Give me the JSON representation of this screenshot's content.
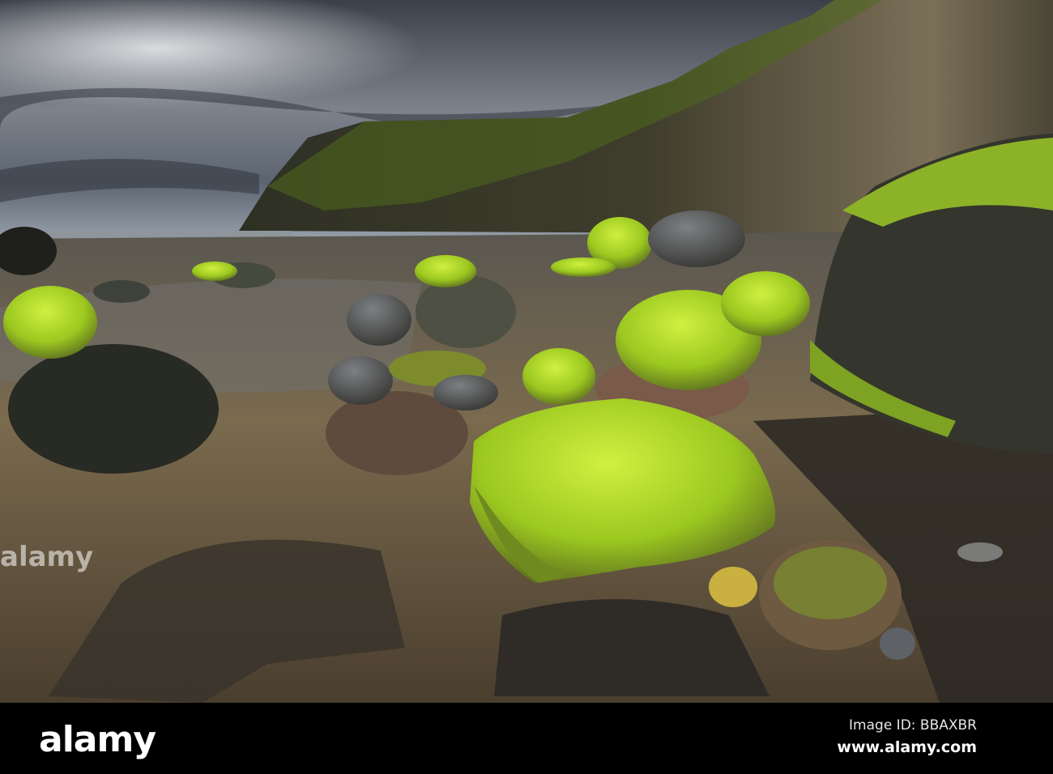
{
  "logo": "alamy",
  "image_id": "Image ID: BBAXBR",
  "website": "www.alamy.com",
  "watermark": "alamy",
  "colors": {
    "sky": "#4a525c",
    "cliff": "#3d3a2c",
    "moss": "#b6e02a",
    "sand": "#7a6648",
    "bar": "#000000"
  }
}
